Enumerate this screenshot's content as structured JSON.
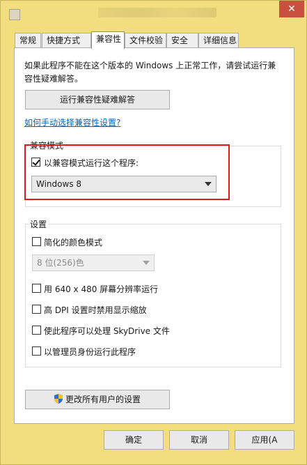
{
  "window": {
    "close_glyph": "✕"
  },
  "tabs": [
    {
      "label": "常规"
    },
    {
      "label": "快捷方式"
    },
    {
      "label": "兼容性"
    },
    {
      "label": "文件校验"
    },
    {
      "label": "安全"
    },
    {
      "label": "详细信息"
    }
  ],
  "intro_text": "如果此程序不能在这个版本的 Windows 上正常工作，请尝试运行兼容性疑难解答。",
  "troubleshooter_button": "运行兼容性疑难解答",
  "manual_link": "如何手动选择兼容性设置?",
  "compat_mode": {
    "group_label": "兼容模式",
    "checkbox_label": "以兼容模式运行这个程序:",
    "checked": true,
    "selected_os": "Windows 8"
  },
  "settings": {
    "group_label": "设置",
    "options": [
      {
        "label": "简化的颜色模式"
      },
      {
        "label": "用 640 x 480 屏幕分辨率运行"
      },
      {
        "label": "高 DPI 设置时禁用显示缩放"
      },
      {
        "label": "使此程序可以处理 SkyDrive 文件"
      },
      {
        "label": "以管理员身份运行此程序"
      }
    ],
    "color_select": "8 位(256)色"
  },
  "all_users_button": "更改所有用户的设置",
  "footer": {
    "ok": "确定",
    "cancel": "取消",
    "apply": "应用(A"
  },
  "colors": {
    "highlight": "#e0181f",
    "link": "#0066cc",
    "window_frame": "#f2de7f"
  }
}
